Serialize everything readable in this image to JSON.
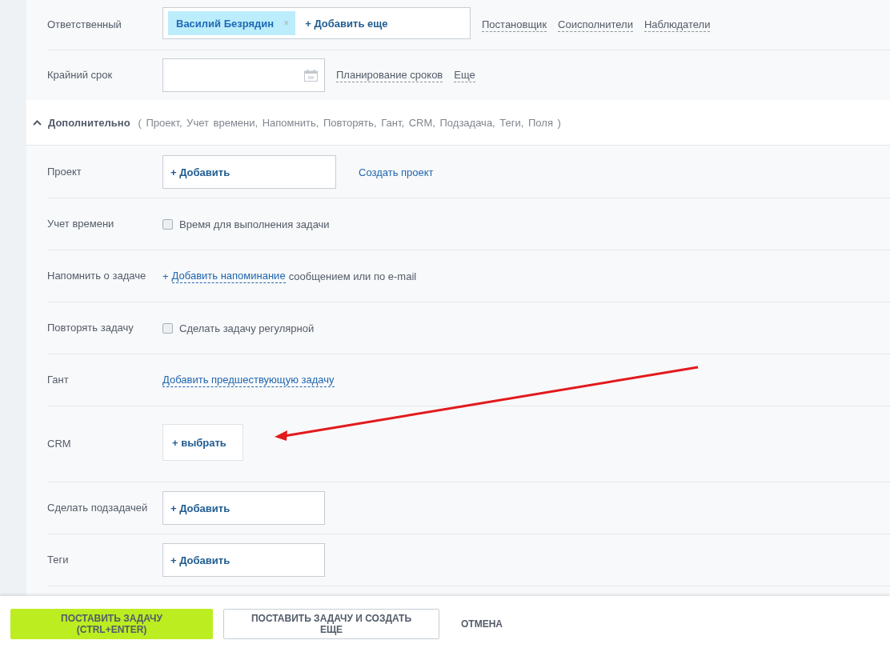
{
  "assignee": {
    "label": "Ответственный",
    "tag": "Василий Безрядин",
    "tag_remove": "×",
    "add": "+ Добавить еще",
    "links": [
      "Постановщик",
      "Соисполнители",
      "Наблюдатели"
    ]
  },
  "deadline": {
    "label": "Крайний срок",
    "links": [
      "Планирование сроков",
      "Еще"
    ]
  },
  "additional": {
    "expanded": true,
    "title": "Дополнительно",
    "summary": "( Проект,  Учет времени,  Напомнить,  Повторять,  Гант,  CRM,  Подзадача,  Теги,  Поля )"
  },
  "rows": [
    {
      "kind": "picker",
      "label": "Проект",
      "button": "+ Добавить",
      "link": "Создать проект"
    },
    {
      "kind": "checkbox",
      "label": "Учет времени",
      "checked": false,
      "text": "Время для выполнения задачи"
    },
    {
      "kind": "reminder",
      "label": "Напомнить о задаче",
      "plus": "+",
      "link": "Добавить напоминание",
      "text": "сообщением или по e-mail"
    },
    {
      "kind": "checkbox",
      "label": "Повторять задачу",
      "checked": false,
      "text": "Сделать задачу регулярной"
    },
    {
      "kind": "link",
      "label": "Гант",
      "link": "Добавить предшествующую задачу"
    },
    {
      "kind": "chooser",
      "label": "CRM",
      "button": "+ выбрать"
    },
    {
      "kind": "picker",
      "label": "Сделать подзадачей",
      "button": "+ Добавить"
    },
    {
      "kind": "picker",
      "label": "Теги",
      "button": "+ Добавить"
    }
  ],
  "footer": [
    {
      "kind": "primary",
      "label": "ПОСТАВИТЬ ЗАДАЧУ (CTRL+ENTER)"
    },
    {
      "kind": "secondary",
      "label": "ПОСТАВИТЬ ЗАДАЧУ И СОЗДАТЬ ЕЩЕ"
    },
    {
      "kind": "link",
      "label": "ОТМЕНА"
    }
  ]
}
